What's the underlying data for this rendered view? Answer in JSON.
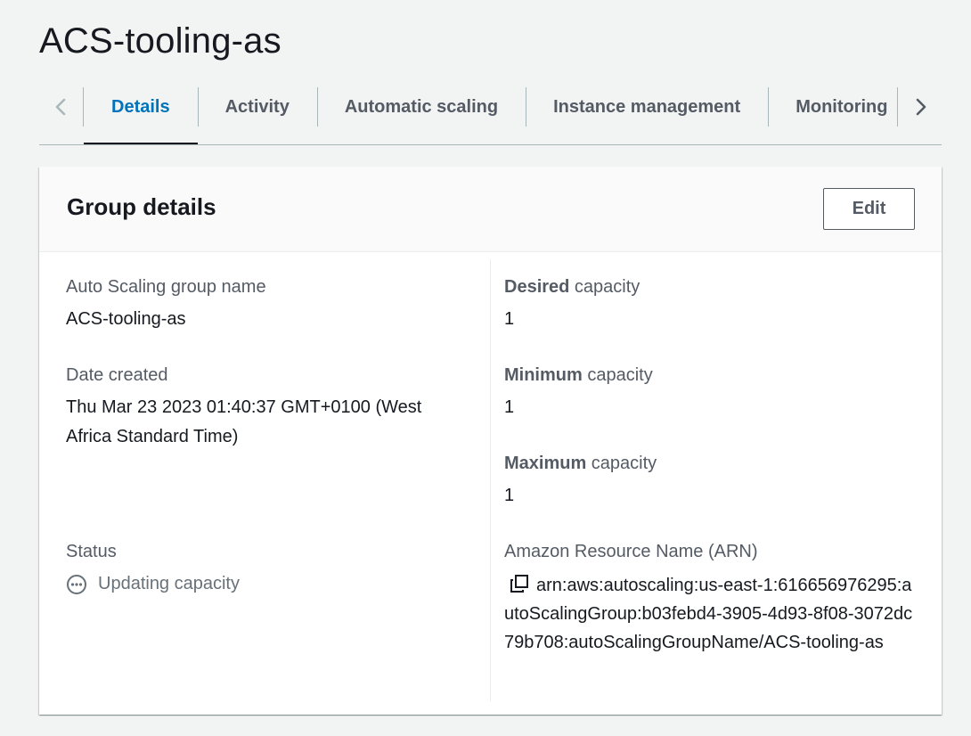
{
  "page": {
    "title": "ACS-tooling-as"
  },
  "tabs": {
    "items": [
      {
        "label": "Details",
        "active": true
      },
      {
        "label": "Activity",
        "active": false
      },
      {
        "label": "Automatic scaling",
        "active": false
      },
      {
        "label": "Instance management",
        "active": false
      },
      {
        "label": "Monitoring",
        "active": false
      }
    ],
    "prev_icon": "chevron-left-icon",
    "next_icon": "chevron-right-icon"
  },
  "group_details": {
    "title": "Group details",
    "edit_label": "Edit",
    "asg_name_label": "Auto Scaling group name",
    "asg_name_value": "ACS-tooling-as",
    "date_created_label": "Date created",
    "date_created_value": "Thu Mar 23 2023 01:40:37 GMT+0100 (West Africa Standard Time)",
    "status_label": "Status",
    "status_value": "Updating capacity",
    "status_icon": "status-pending-icon",
    "desired_bold": "Desired",
    "desired_rest": " capacity",
    "desired_value": "1",
    "minimum_bold": "Minimum",
    "minimum_rest": " capacity",
    "minimum_value": "1",
    "maximum_bold": "Maximum",
    "maximum_rest": " capacity",
    "maximum_value": "1",
    "arn_label": "Amazon Resource Name (ARN)",
    "arn_value": "arn:aws:autoscaling:us-east-1:616656976295:autoScalingGroup:b03febd4-3905-4d93-8f08-3072dc79b708:autoScalingGroupName/ACS-tooling-as",
    "copy_icon": "copy-icon"
  },
  "colors": {
    "accent": "#0073bb",
    "text": "#16191f",
    "muted": "#545b64",
    "background": "#f2f3f3"
  }
}
